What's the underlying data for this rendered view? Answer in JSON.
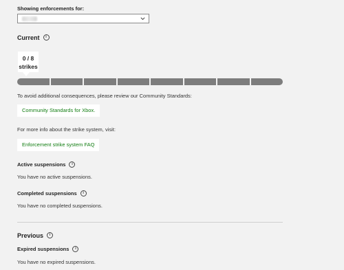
{
  "header": {
    "showing_label": "Showing enforcements for:",
    "selected_account": ""
  },
  "current": {
    "title": "Current",
    "strikes": {
      "count_text": "0 / 8",
      "unit": "strikes",
      "current": 0,
      "total": 8
    },
    "review_text": "To avoid additional consequences, please review our Community Standards:",
    "community_link": "Community Standards for Xbox.",
    "more_info_text": "For more info about the strike system, visit:",
    "faq_link": "Enforcement strike system FAQ",
    "active_title": "Active suspensions",
    "active_text": "You have no active suspensions.",
    "completed_title": "Completed suspensions",
    "completed_text": "You have no completed suspensions."
  },
  "previous": {
    "title": "Previous",
    "expired_title": "Expired suspensions",
    "expired_text": "You have no expired suspensions."
  },
  "colors": {
    "background": "#f2f2f2",
    "link": "#107c10",
    "bar_segment": "#7d7d7d"
  },
  "icons": {
    "info": "info-circle-icon",
    "dropdown": "chevron-down-icon"
  }
}
